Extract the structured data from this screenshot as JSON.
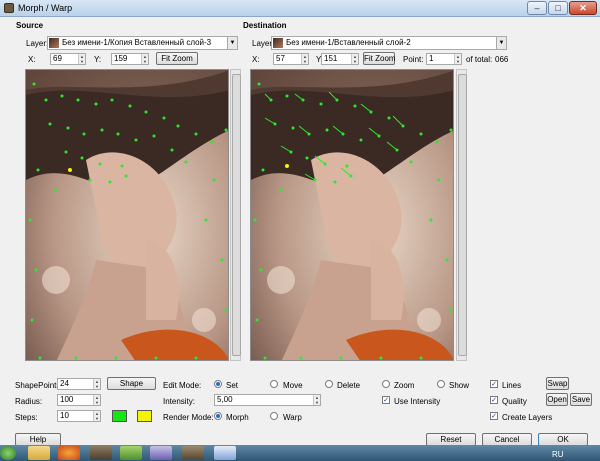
{
  "window": {
    "title": "Morph / Warp",
    "minimize": "–",
    "maximize": "□",
    "close": "✕"
  },
  "source": {
    "heading": "Source",
    "layer_label": "Layer:",
    "layer_value": "Без имени-1/Копия Вставленный слой-3",
    "x_label": "X:",
    "x_value": "69",
    "y_label": "Y:",
    "y_value": "159",
    "fit_zoom": "Fit Zoom"
  },
  "destination": {
    "heading": "Destination",
    "layer_label": "Layer:",
    "layer_value": "Без имени-1/Вставленный слой-2",
    "x_label": "X:",
    "x_value": "57",
    "y_label": "Y:",
    "y_value": "151",
    "fit_zoom": "Fit Zoom",
    "point_label": "Point:",
    "point_value": "1",
    "of_total_label": "of total:",
    "of_total_value": "066"
  },
  "controls": {
    "shape_points_label": "ShapePoints:",
    "shape_points_value": "24",
    "shape_button": "Shape",
    "radius_label": "Radius:",
    "radius_value": "100",
    "steps_label": "Steps:",
    "steps_value": "10",
    "swatch_colors": [
      "#16e616",
      "#f4f400"
    ],
    "edit_mode_label": "Edit Mode:",
    "edit_modes": [
      "Set",
      "Move",
      "Delete",
      "Zoom",
      "Show"
    ],
    "edit_mode_selected": "Set",
    "intensity_label": "Intensity:",
    "intensity_value": "5,00",
    "use_intensity": "Use Intensity",
    "render_mode_label": "Render Mode:",
    "render_modes": [
      "Morph",
      "Warp"
    ],
    "render_mode_selected": "Morph",
    "lines": "Lines",
    "quality": "Quality",
    "create_layers": "Create Layers",
    "swap": "Swap",
    "open": "Open",
    "save": "Save"
  },
  "footer": {
    "help": "Help",
    "reset": "Reset",
    "cancel": "Cancel",
    "ok": "OK"
  },
  "taskbar": {
    "language": "RU"
  },
  "colors": {
    "point_marker": "#2ee82e",
    "point_selected": "#f4f400"
  }
}
